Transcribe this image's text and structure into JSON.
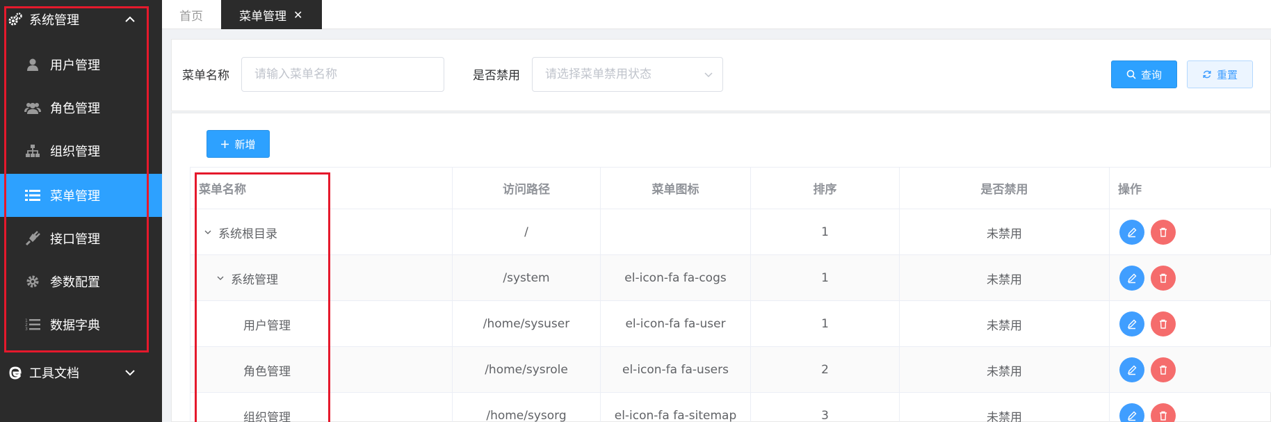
{
  "sidebar": {
    "group_system": {
      "label": "系统管理",
      "icon": "cogs-icon",
      "chevron": "chevron-up-icon"
    },
    "items": [
      {
        "label": "用户管理",
        "icon": "user-icon"
      },
      {
        "label": "角色管理",
        "icon": "users-icon"
      },
      {
        "label": "组织管理",
        "icon": "sitemap-icon"
      },
      {
        "label": "菜单管理",
        "icon": "list-icon",
        "active": true
      },
      {
        "label": "接口管理",
        "icon": "plug-icon"
      },
      {
        "label": "参数配置",
        "icon": "gear-icon"
      },
      {
        "label": "数据字典",
        "icon": "list-ol-icon"
      }
    ],
    "group_tools": {
      "label": "工具文档",
      "icon": "edge-icon",
      "chevron": "chevron-down-icon"
    },
    "active_color": "#2da1ff",
    "bg_color": "#2b2b2b"
  },
  "tabs": {
    "home": "首页",
    "active": "菜单管理",
    "close_glyph": "✕"
  },
  "filter": {
    "name_label": "菜单名称",
    "name_placeholder": "请输入菜单名称",
    "disabled_label": "是否禁用",
    "disabled_placeholder": "请选择菜单禁用状态",
    "query_button": "查询",
    "reset_button": "重置"
  },
  "toolbar": {
    "add_button": "新增"
  },
  "table": {
    "columns": [
      "菜单名称",
      "访问路径",
      "菜单图标",
      "排序",
      "是否禁用",
      "操作"
    ],
    "rows": [
      {
        "name": "系统根目录",
        "path": "/",
        "icon": "",
        "order": "1",
        "disabled": "未禁用"
      },
      {
        "name": "系统管理",
        "path": "/system",
        "icon": "el-icon-fa fa-cogs",
        "order": "1",
        "disabled": "未禁用"
      },
      {
        "name": "用户管理",
        "path": "/home/sysuser",
        "icon": "el-icon-fa fa-user",
        "order": "1",
        "disabled": "未禁用"
      },
      {
        "name": "角色管理",
        "path": "/home/sysrole",
        "icon": "el-icon-fa fa-users",
        "order": "2",
        "disabled": "未禁用"
      },
      {
        "name": "组织管理",
        "path": "/home/sysorg",
        "icon": "el-icon-fa fa-sitemap",
        "order": "3",
        "disabled": "未禁用"
      }
    ]
  }
}
